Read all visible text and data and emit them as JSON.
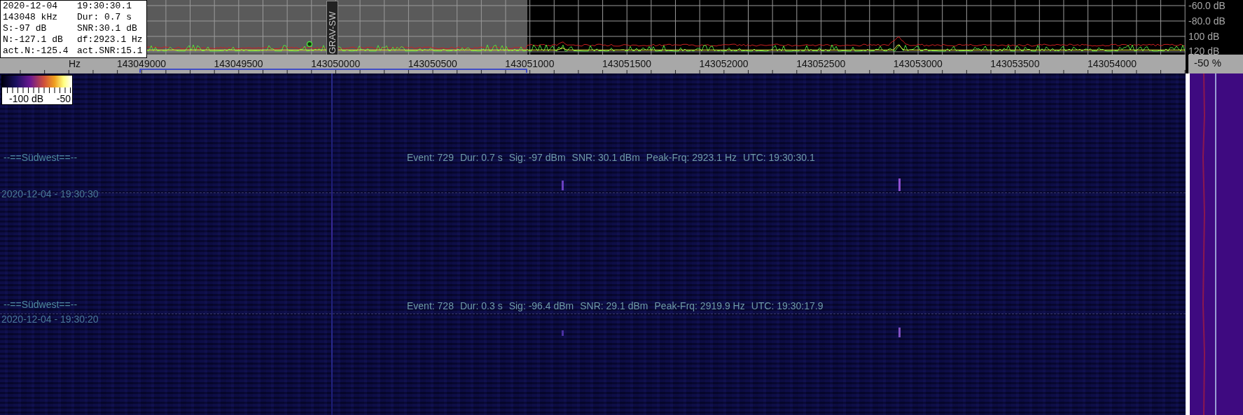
{
  "info_box": {
    "lines": [
      {
        "left": "2020-12-04",
        "right": "19:30:30.1"
      },
      {
        "left": "143048 kHz",
        "right": "Dur: 0.7 s"
      },
      {
        "left": "S:-97 dB",
        "right": "SNR:30.1 dB"
      },
      {
        "left": "N:-127.1 dB",
        "right": "df:2923.1 Hz"
      },
      {
        "left": "act.N:-125.4",
        "right": "act.SNR:15.1"
      }
    ]
  },
  "spectrum": {
    "marker_label": "GRAV-SW",
    "db_labels": [
      "-60.0 dB",
      "-80.0 dB",
      "100 dB",
      "120 dB"
    ]
  },
  "frequency_axis": {
    "unit_label": "Hz",
    "labels": [
      "143049000",
      "143049500",
      "143050000",
      "143050500",
      "143051000",
      "143051500",
      "143052000",
      "143052500",
      "143053000",
      "143053500",
      "143054000"
    ],
    "percent_label": "-50 %"
  },
  "color_legend": {
    "min_label": "-100 dB",
    "max_label": "-50"
  },
  "waterfall": {
    "events": [
      {
        "station": "--==Südwest==--",
        "details": [
          "Event: 729",
          "Dur: 0.7 s",
          "Sig: -97 dBm",
          "SNR: 30.1 dBm",
          "Peak-Frq: 2923.1 Hz",
          "UTC: 19:30:30.1"
        ],
        "timestamp": "2020-12-04 - 19:30:30"
      },
      {
        "station": "--==Südwest==--",
        "details": [
          "Event: 728",
          "Dur: 0.3 s",
          "Sig: -96.4 dBm",
          "SNR: 29.1 dBm",
          "Peak-Frq: 2919.9 Hz",
          "UTC: 19:30:17.9"
        ],
        "timestamp": "2020-12-04 - 19:30:20"
      }
    ]
  }
}
